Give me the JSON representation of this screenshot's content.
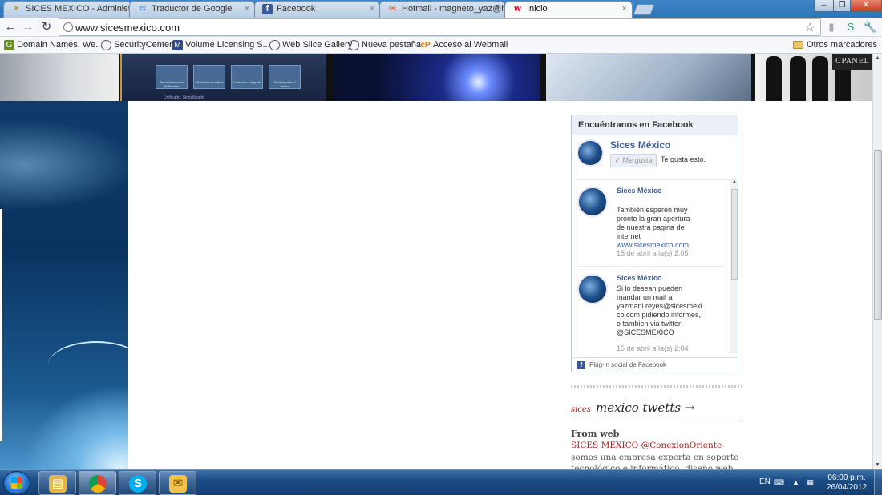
{
  "browser": {
    "tabs": [
      {
        "label": "SICES MEXICO - Administra",
        "icon": "sices-icon",
        "active": false
      },
      {
        "label": "Traductor de Google",
        "icon": "google-translate-icon",
        "active": false
      },
      {
        "label": "Facebook",
        "icon": "facebook-icon",
        "active": false
      },
      {
        "label": "Hotmail - magneto_yaz@h",
        "icon": "hotmail-icon",
        "active": false
      },
      {
        "label": "Inicio",
        "icon": "wix-icon",
        "active": true
      }
    ],
    "url": "www.sicesmexico.com",
    "bookmarks": [
      {
        "label": "Domain Names, We...",
        "icon": "godaddy-icon"
      },
      {
        "label": "SecurityCenter",
        "icon": "web-slice-icon"
      },
      {
        "label": "Volume Licensing S...",
        "icon": "microsoft-icon"
      },
      {
        "label": "Web Slice Gallery",
        "icon": "web-slice-icon"
      },
      {
        "label": "Nueva pestaña",
        "icon": "web-slice-icon"
      },
      {
        "label": "Acceso al Webmail",
        "icon": "cpanel-icon"
      }
    ],
    "other_bookmarks": "Otros marcadores"
  },
  "page": {
    "banner": {
      "cpanel_label": "CPANEL",
      "tile_labels": [
        "Comunicaciones Unificadas",
        "Eficiencia operativa",
        "Protección integrada",
        "Gestión para el futuro"
      ],
      "tile_caption": "Unificado. Simplificado"
    },
    "facebook": {
      "heading": "Encuéntranos en Facebook",
      "page_name": "Sices México",
      "like_button": "✓ Me gusta",
      "liked_text": "Te gusta esto.",
      "posts": [
        {
          "author": "Sices México",
          "text": "También esperen muy\npronto la gran apertura\nde nuestra pagina de\ninternet",
          "link": "www.sicesmexico.com",
          "time": "15 de abril a la(s) 2:05"
        },
        {
          "author": "Sices México",
          "text": "Si lo desean pueden\nmandar un mail a\nyazmani.reyes@sicesmexi\nco.com pidiendo informes,\no tambien via twitter:\n@SICESMEXICO",
          "link": "",
          "time": "15 de abril a la(s) 2:04"
        }
      ],
      "footer": "Plug-in social de Facebook"
    },
    "twitter": {
      "heading_small": "sices",
      "heading": "mexico twetts →",
      "from": "From web",
      "tweet_highlight": "SICES MÉXICO @ConexionOriente",
      "tweet_text": " somos una empresa experta en soporte tecnológico e informático, diseño web, electrónica, etc."
    }
  },
  "taskbar": {
    "apps": [
      "windows-explorer-icon",
      "chrome-icon",
      "skype-icon",
      "outlook-icon"
    ],
    "language": "EN",
    "time": "06:00 p.m.",
    "date": "26/04/2012"
  }
}
